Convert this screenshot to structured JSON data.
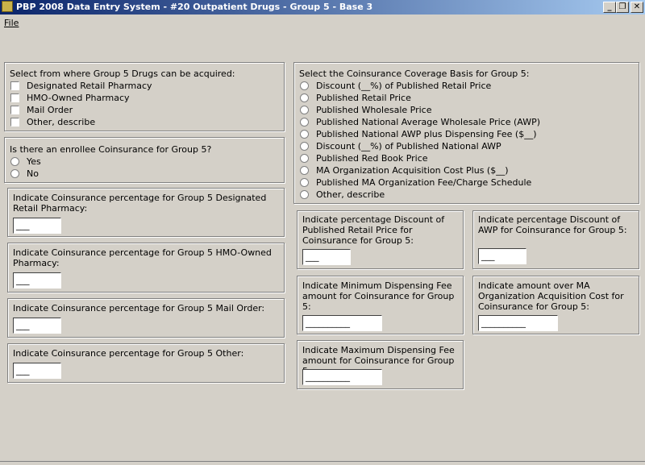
{
  "window": {
    "title": "PBP 2008 Data Entry System - #20 Outpatient Drugs - Group 5 - Base 3",
    "buttons": {
      "minimize": "_",
      "restore": "❐",
      "close": "✕"
    }
  },
  "menu": {
    "file": "File"
  },
  "acquire": {
    "prompt": "Select from where Group 5 Drugs can be acquired:",
    "options": [
      "Designated Retail Pharmacy",
      "HMO-Owned Pharmacy",
      "Mail Order",
      "Other, describe"
    ]
  },
  "coinsurance": {
    "prompt": "Is there an enrollee Coinsurance for Group 5?",
    "options": [
      "Yes",
      "No"
    ]
  },
  "pct_retail": {
    "prompt": "Indicate Coinsurance percentage for Group 5 Designated Retail Pharmacy:",
    "value": "___"
  },
  "pct_hmo": {
    "prompt": "Indicate Coinsurance percentage for Group 5 HMO-Owned Pharmacy:",
    "value": "___"
  },
  "pct_mail": {
    "prompt": "Indicate Coinsurance percentage for Group 5 Mail Order:",
    "value": "___"
  },
  "pct_other": {
    "prompt": "Indicate Coinsurance percentage for Group 5 Other:",
    "value": "___"
  },
  "basis": {
    "prompt": "Select the Coinsurance Coverage Basis for Group 5:",
    "options": [
      "Discount (__%) of Published Retail Price",
      "Published Retail Price",
      "Published Wholesale Price",
      "Published National Average Wholesale Price (AWP)",
      "Published National AWP plus Dispensing Fee ($__)",
      "Discount (__%) of Published National AWP",
      "Published Red Book Price",
      "MA Organization Acquisition Cost Plus ($__)",
      "Published MA Organization Fee/Charge Schedule",
      "Other, describe"
    ]
  },
  "disc_retail": {
    "prompt": "Indicate percentage Discount of Published Retail Price for Coinsurance for Group 5:",
    "value": "___"
  },
  "disc_awp": {
    "prompt": "Indicate percentage Discount of AWP for Coinsurance for Group 5:",
    "value": "___"
  },
  "min_fee": {
    "prompt": "Indicate Minimum Dispensing Fee amount for Coinsurance for Group 5:",
    "value": "__________"
  },
  "over_cost": {
    "prompt": "Indicate amount over MA Organization Acquisition Cost for Coinsurance for Group 5:",
    "value": "__________"
  },
  "max_fee": {
    "prompt": "Indicate Maximum Dispensing Fee amount for Coinsurance for Group 5:",
    "value": "__________"
  }
}
